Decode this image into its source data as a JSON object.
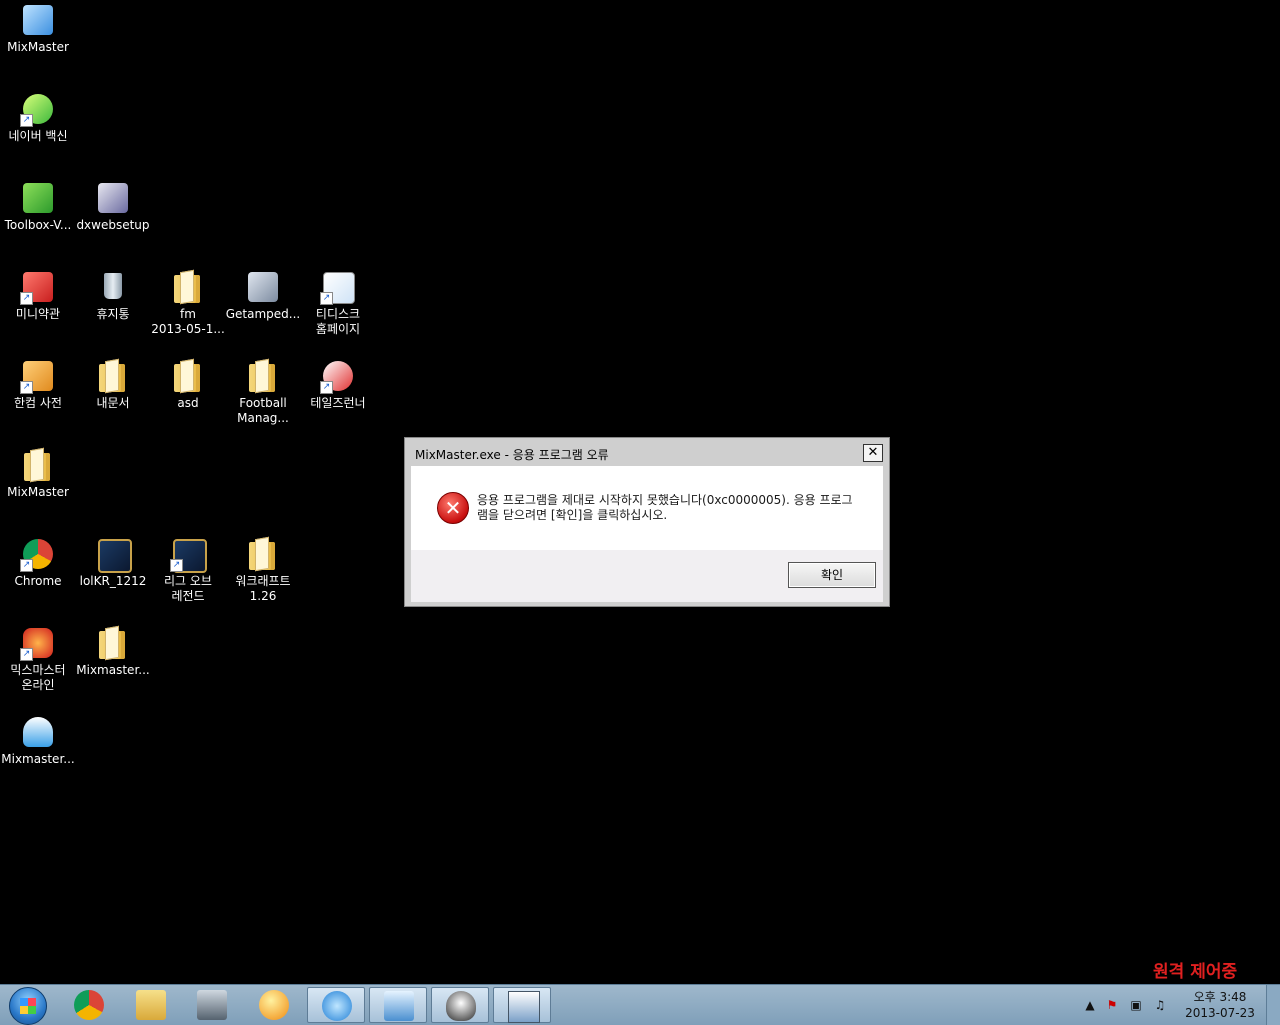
{
  "desktop": {
    "icons": [
      {
        "label": "MixMaster",
        "icon": "mixmaster-app-icon",
        "shortcut": false
      },
      {
        "label": "네이버 백신",
        "icon": "naver-vaccine-icon",
        "shortcut": true
      },
      {
        "label": "Toolbox-V...",
        "icon": "toolbox-icon",
        "shortcut": false
      },
      {
        "label": "dxwebsetup",
        "icon": "dxwebsetup-icon",
        "shortcut": false
      },
      {
        "label": "미니약관",
        "icon": "mini-terms-icon",
        "shortcut": true
      },
      {
        "label": "휴지통",
        "icon": "recycle-bin-icon",
        "shortcut": false
      },
      {
        "label": "fm\n2013-05-1...",
        "icon": "folder-icon",
        "shortcut": false
      },
      {
        "label": "Getamped...",
        "icon": "getamped-icon",
        "shortcut": false
      },
      {
        "label": "티디스크\n홈페이지",
        "icon": "tdisk-icon",
        "shortcut": true
      },
      {
        "label": "한컴 사전",
        "icon": "hancom-dictionary-icon",
        "shortcut": true
      },
      {
        "label": "내문서",
        "icon": "folder-icon",
        "shortcut": false
      },
      {
        "label": "asd",
        "icon": "folder-icon",
        "shortcut": false
      },
      {
        "label": "Football\nManag...",
        "icon": "folder-icon",
        "shortcut": false
      },
      {
        "label": "테일즈런너",
        "icon": "talesrunner-icon",
        "shortcut": true
      },
      {
        "label": "MixMaster",
        "icon": "folder-icon",
        "shortcut": false
      },
      {
        "label": "Chrome",
        "icon": "chrome-icon",
        "shortcut": true
      },
      {
        "label": "lolKR_1212",
        "icon": "league-of-legends-icon",
        "shortcut": false
      },
      {
        "label": "리그 오브\n레전드",
        "icon": "league-of-legends-icon",
        "shortcut": true
      },
      {
        "label": "워크래프트\n1.26",
        "icon": "folder-icon",
        "shortcut": false
      },
      {
        "label": "믹스마스터\n온라인",
        "icon": "mixmaster-online-icon",
        "shortcut": true
      },
      {
        "label": "Mixmaster...",
        "icon": "folder-icon",
        "shortcut": false
      },
      {
        "label": "Mixmaster...",
        "icon": "zip-archive-icon",
        "shortcut": false
      }
    ]
  },
  "dialog": {
    "title": "MixMaster.exe - 응용 프로그램 오류",
    "close_label": "✕",
    "message": "응용 프로그램을 제대로 시작하지 못했습니다(0xc0000005). 응용 프로그램을 닫으려면 [확인]을 클릭하십시오.",
    "ok_label": "확인"
  },
  "overlay": {
    "remote_control_label": "원격 제어중"
  },
  "taskbar": {
    "buttons": [
      {
        "icon": "chrome-icon",
        "active": false
      },
      {
        "icon": "file-explorer-icon",
        "active": false
      },
      {
        "icon": "network-monitor-icon",
        "active": false
      },
      {
        "icon": "media-player-icon",
        "active": false
      },
      {
        "icon": "internet-explorer-icon",
        "active": true
      },
      {
        "icon": "remote-desktop-icon",
        "active": true
      },
      {
        "icon": "messenger-penguin-icon",
        "active": true
      },
      {
        "icon": "window-app-icon",
        "active": true
      }
    ],
    "tray": {
      "time": "오후 3:48",
      "date": "2013-07-23"
    }
  },
  "colors": {
    "desktop": "#000000",
    "remote_label": "#e02020",
    "taskbar": "#8fadc5",
    "error_red": "#c80f0f"
  }
}
